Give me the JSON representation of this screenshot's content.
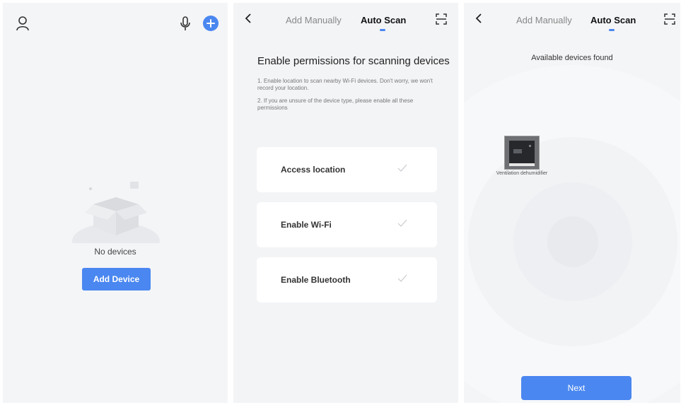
{
  "home": {
    "empty_text": "No devices",
    "add_device_label": "Add Device",
    "icons": [
      "user-icon",
      "microphone-icon",
      "plus-icon"
    ]
  },
  "permissions": {
    "tabs": [
      "Add Manually",
      "Auto Scan"
    ],
    "active_tab": "Auto Scan",
    "title": "Enable permissions for scanning devices",
    "desc_1": "1. Enable location to scan nearby Wi-Fi devices. Don't worry, we won't record your location.",
    "desc_2": "2. If you are unsure of the device type, please enable all these permissions",
    "items": [
      {
        "label": "Access location"
      },
      {
        "label": "Enable Wi-Fi"
      },
      {
        "label": "Enable Bluetooth"
      }
    ]
  },
  "scan": {
    "tabs": [
      "Add Manually",
      "Auto Scan"
    ],
    "active_tab": "Auto Scan",
    "title": "Available devices found",
    "device_name": "Ventilation dehumidifier",
    "next_label": "Next"
  },
  "colors": {
    "accent": "#4a87f0",
    "background": "#f4f5f7",
    "card": "#ffffff"
  }
}
